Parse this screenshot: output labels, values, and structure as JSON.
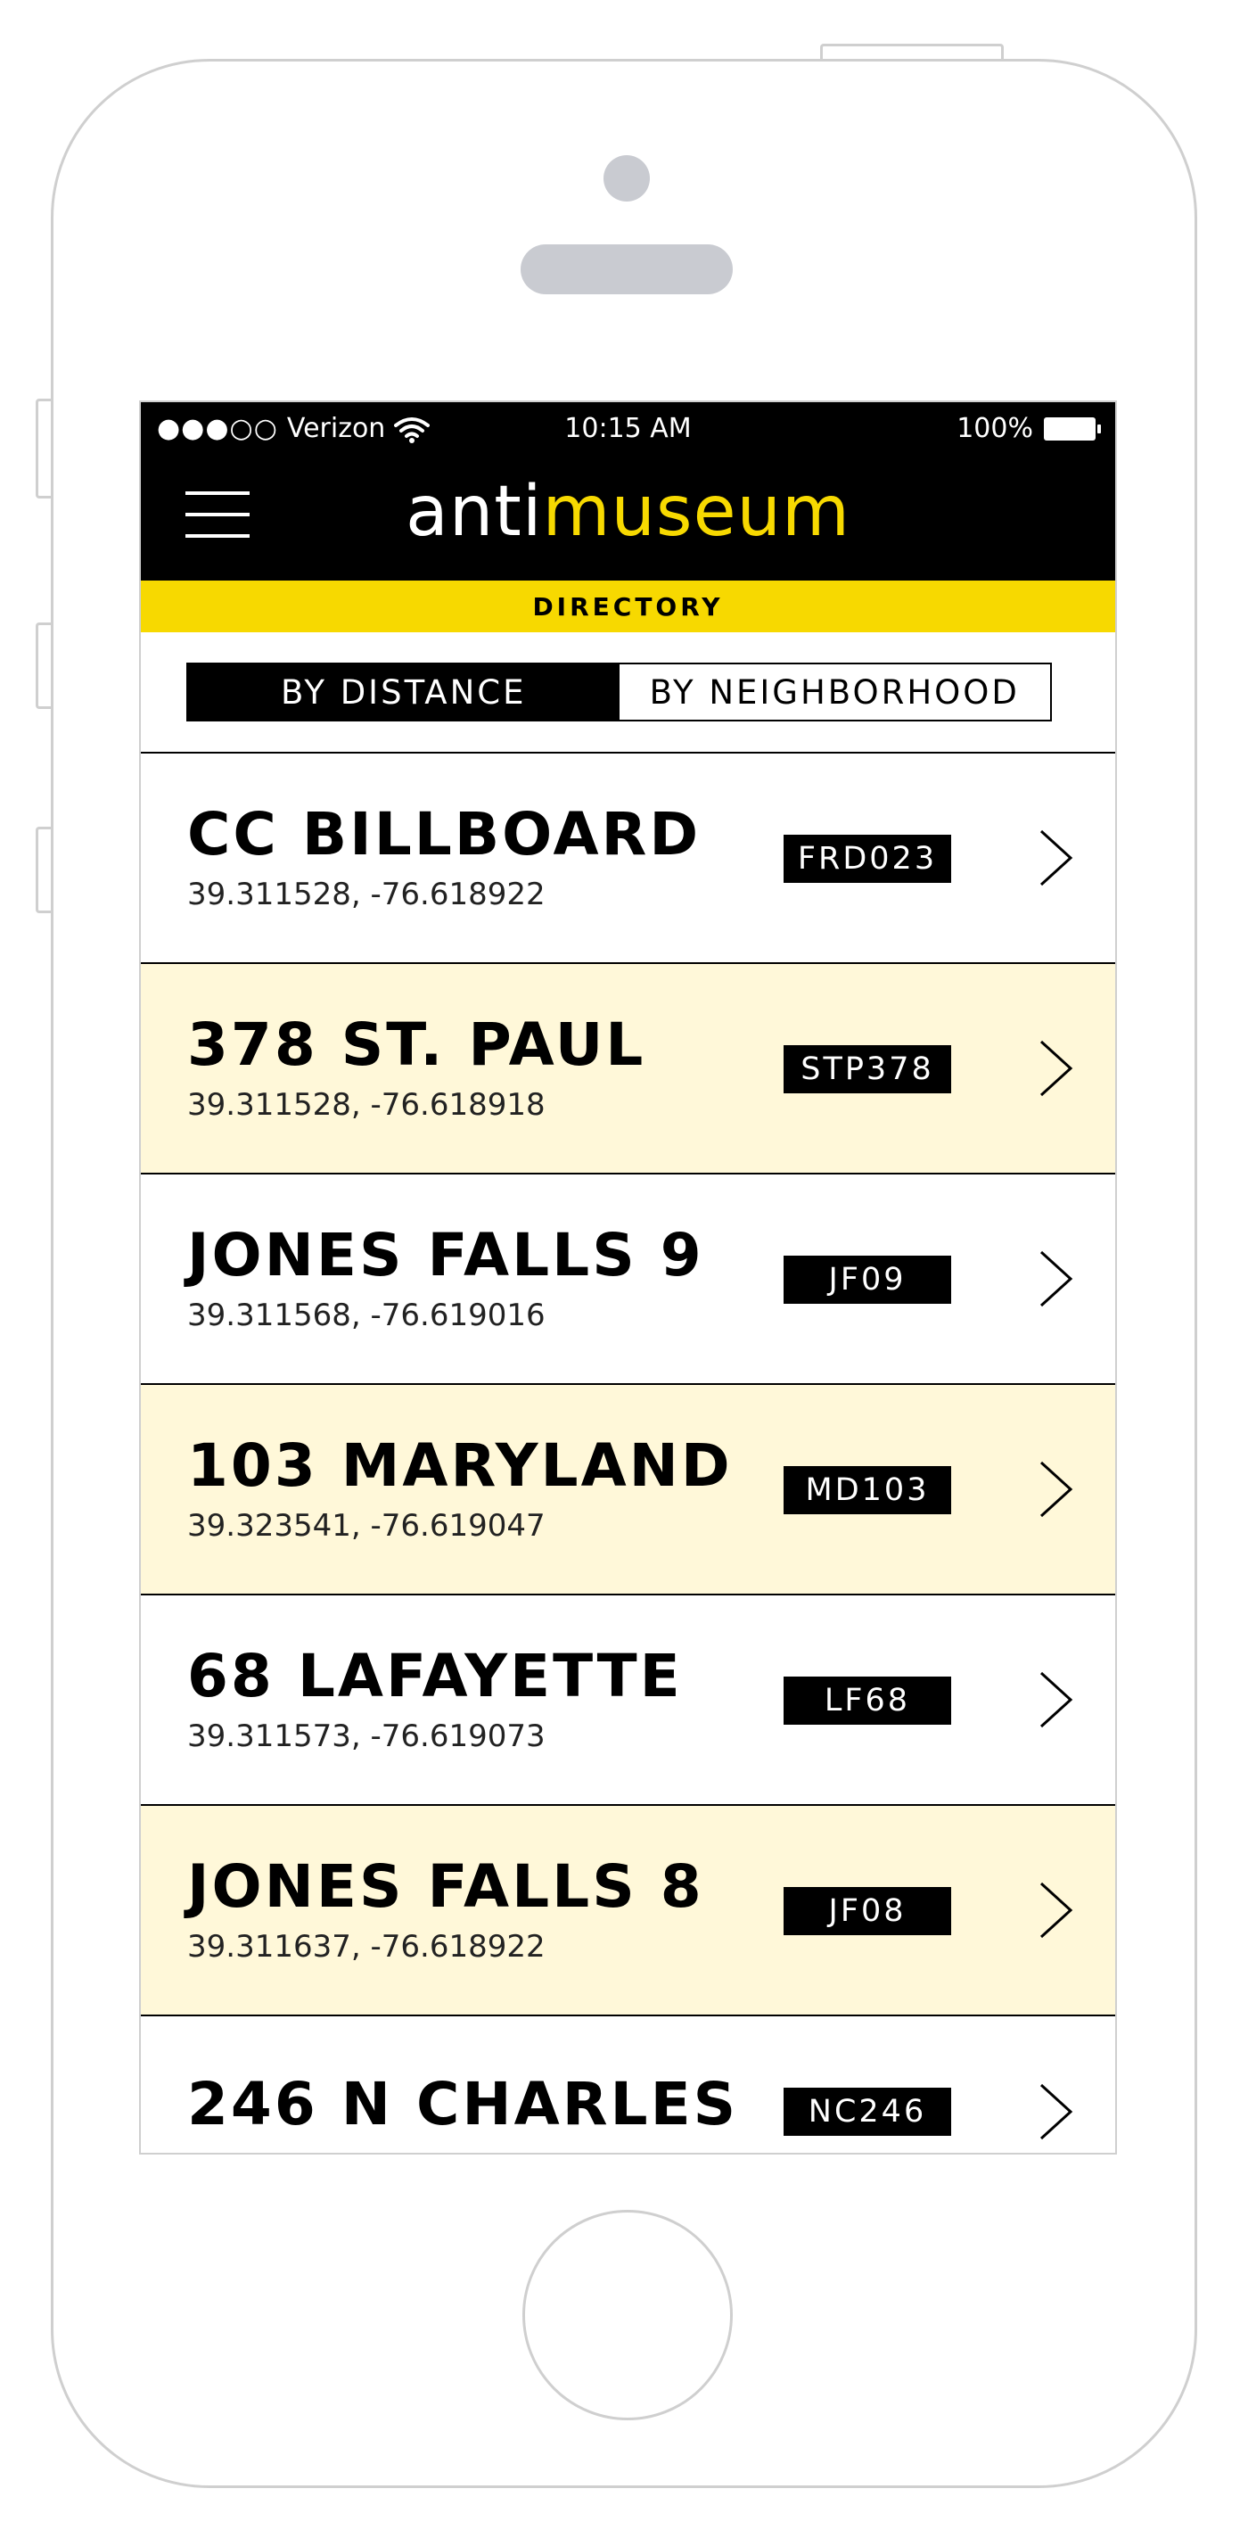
{
  "status_bar": {
    "signal": "●●●○○",
    "carrier": "Verizon",
    "time": "10:15 AM",
    "battery_percent": "100%",
    "icons": [
      "wifi-icon",
      "battery-icon"
    ]
  },
  "header": {
    "brand_part1": "anti",
    "brand_part2": "museum",
    "menu_icon": "hamburger-menu-icon"
  },
  "section_title": "DIRECTORY",
  "sort_tabs": [
    {
      "label": "BY DISTANCE",
      "active": true
    },
    {
      "label": "BY NEIGHBORHOOD",
      "active": false
    }
  ],
  "locations": [
    {
      "name": "CC BILLBOARD",
      "coords": "39.311528, -76.618922",
      "code": "FRD023"
    },
    {
      "name": "378 ST. PAUL",
      "coords": "39.311528, -76.618918",
      "code": "STP378"
    },
    {
      "name": "JONES FALLS 9",
      "coords": "39.311568, -76.619016",
      "code": "JF09"
    },
    {
      "name": "103 MARYLAND",
      "coords": "39.323541, -76.619047",
      "code": "MD103"
    },
    {
      "name": "68 LAFAYETTE",
      "coords": "39.311573, -76.619073",
      "code": "LF68"
    },
    {
      "name": "JONES FALLS 8",
      "coords": "39.311637, -76.618922",
      "code": "JF08"
    },
    {
      "name": "246 N CHARLES",
      "coords": "",
      "code": "NC246"
    }
  ],
  "colors": {
    "accent_yellow": "#f7d900",
    "alt_row": "#fff8d9",
    "black": "#000000"
  }
}
